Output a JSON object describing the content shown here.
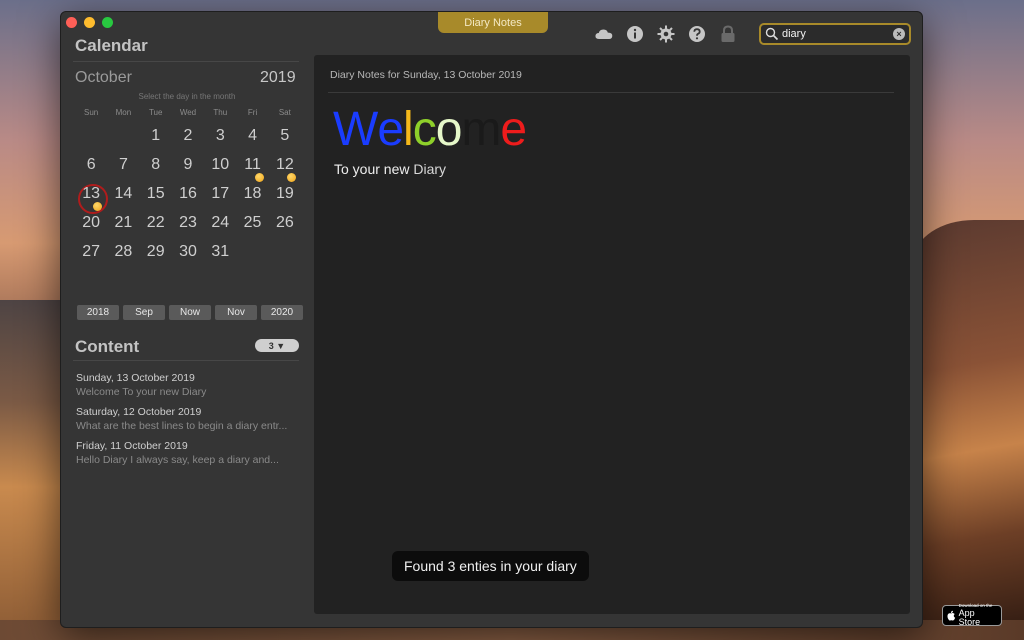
{
  "window": {
    "title": "Diary Notes"
  },
  "search": {
    "value": "diary"
  },
  "toolbar": {
    "icons": [
      "cloud-icon",
      "info-icon",
      "gear-icon",
      "help-icon",
      "lock-icon"
    ]
  },
  "calendar": {
    "title": "Calendar",
    "month": "October",
    "year": "2019",
    "hint": "Select the day in the month",
    "weekdays": [
      "Sun",
      "Mon",
      "Tue",
      "Wed",
      "Thu",
      "Fri",
      "Sat"
    ],
    "days": [
      {
        "label": ""
      },
      {
        "label": ""
      },
      {
        "label": "1"
      },
      {
        "label": "2"
      },
      {
        "label": "3"
      },
      {
        "label": "4"
      },
      {
        "label": "5"
      },
      {
        "label": "6"
      },
      {
        "label": "7"
      },
      {
        "label": "8"
      },
      {
        "label": "9"
      },
      {
        "label": "10"
      },
      {
        "label": "11",
        "has_entry": true
      },
      {
        "label": "12",
        "has_entry": true
      },
      {
        "label": "13",
        "has_entry": true,
        "today": true
      },
      {
        "label": "14"
      },
      {
        "label": "15"
      },
      {
        "label": "16"
      },
      {
        "label": "17"
      },
      {
        "label": "18"
      },
      {
        "label": "19"
      },
      {
        "label": "20"
      },
      {
        "label": "21"
      },
      {
        "label": "22"
      },
      {
        "label": "23"
      },
      {
        "label": "24"
      },
      {
        "label": "25"
      },
      {
        "label": "26"
      },
      {
        "label": "27"
      },
      {
        "label": "28"
      },
      {
        "label": "29"
      },
      {
        "label": "30"
      },
      {
        "label": "31"
      }
    ],
    "nav_buttons": [
      "2018",
      "Sep",
      "Now",
      "Nov",
      "2020"
    ]
  },
  "content": {
    "title": "Content",
    "count_badge": "3 ▼",
    "entries": [
      {
        "date": "Sunday, 13 October 2019",
        "text": "Welcome To your new Diary"
      },
      {
        "date": "Saturday, 12 October 2019",
        "text": "What are the best lines to begin a diary entr..."
      },
      {
        "date": "Friday, 11 October 2019",
        "text": "Hello Diary    I always say, keep a diary and..."
      }
    ]
  },
  "main": {
    "header": "Diary Notes for Sunday, 13 October 2019",
    "welcome_letters": [
      {
        "char": "W",
        "color": "#1a3cff"
      },
      {
        "char": "e",
        "color": "#1a3cff"
      },
      {
        "char": "l",
        "color": "#f4b81a"
      },
      {
        "char": "c",
        "color": "#8ed02a"
      },
      {
        "char": "o",
        "color": "#e6f8c9"
      },
      {
        "char": "m",
        "color": "#1a1a1a"
      },
      {
        "char": "e",
        "color": "#ee1c1c"
      }
    ],
    "subline_part1": "To your new",
    "subline_part2": "Diary",
    "toast": "Found 3 enties in your diary"
  },
  "appstore": {
    "small": "Download on the",
    "big": "App Store"
  }
}
